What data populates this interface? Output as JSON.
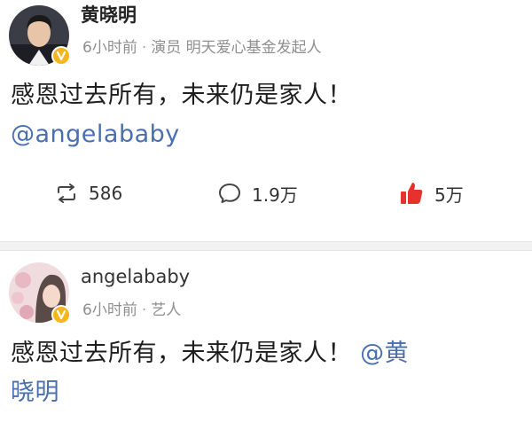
{
  "post_1": {
    "user_name": "黄晓明",
    "meta": {
      "time": "6小时前",
      "sep": "·",
      "bio": "演员 明天爱心基金发起人"
    },
    "text_line1": "感恩过去所有，未来仍是家人！",
    "text_line2": "@angelababy",
    "actions": {
      "repost_icon": "repost-icon",
      "repost_count": "586",
      "comment_icon": "comment-icon",
      "comment_count": "1.9万",
      "like_icon": "thumbs-up-icon",
      "like_count": "5万",
      "like_color": "#e5322d"
    }
  },
  "post_2": {
    "user_name": "angelababy",
    "meta": {
      "time": "6小时前",
      "sep": "·",
      "bio": "艺人"
    },
    "text_line1": "感恩过去所有，未来仍是家人！",
    "mention_part1": "@黄",
    "text_line2": "晓明"
  },
  "colors": {
    "verified_badge": "#f6b51c",
    "mention": "#4a6fb0",
    "meta_text": "#8f8f8f"
  }
}
